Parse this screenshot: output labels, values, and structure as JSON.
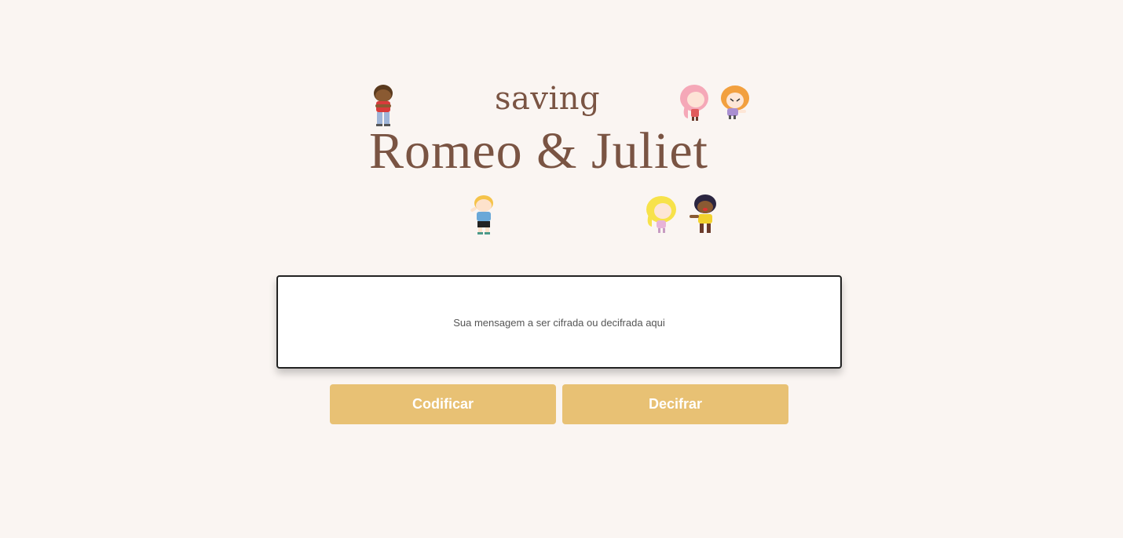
{
  "logo": {
    "line1": "saving",
    "line2": "Romeo & Juliet",
    "text_color": "#7a5443",
    "characters": [
      "boy-brown-red-shirt-icon",
      "girl-pink-hair-icon",
      "girl-orange-hair-icon",
      "boy-blonde-blue-shirt-icon",
      "girl-blonde-icon",
      "boy-dark-hair-yellow-shirt-icon"
    ]
  },
  "message": {
    "placeholder": "Sua mensagem a ser cifrada ou decifrada aqui",
    "value": ""
  },
  "buttons": {
    "encode_label": "Codificar",
    "decode_label": "Decifrar",
    "color": "#e8c174"
  },
  "background_color": "#faf5f2"
}
